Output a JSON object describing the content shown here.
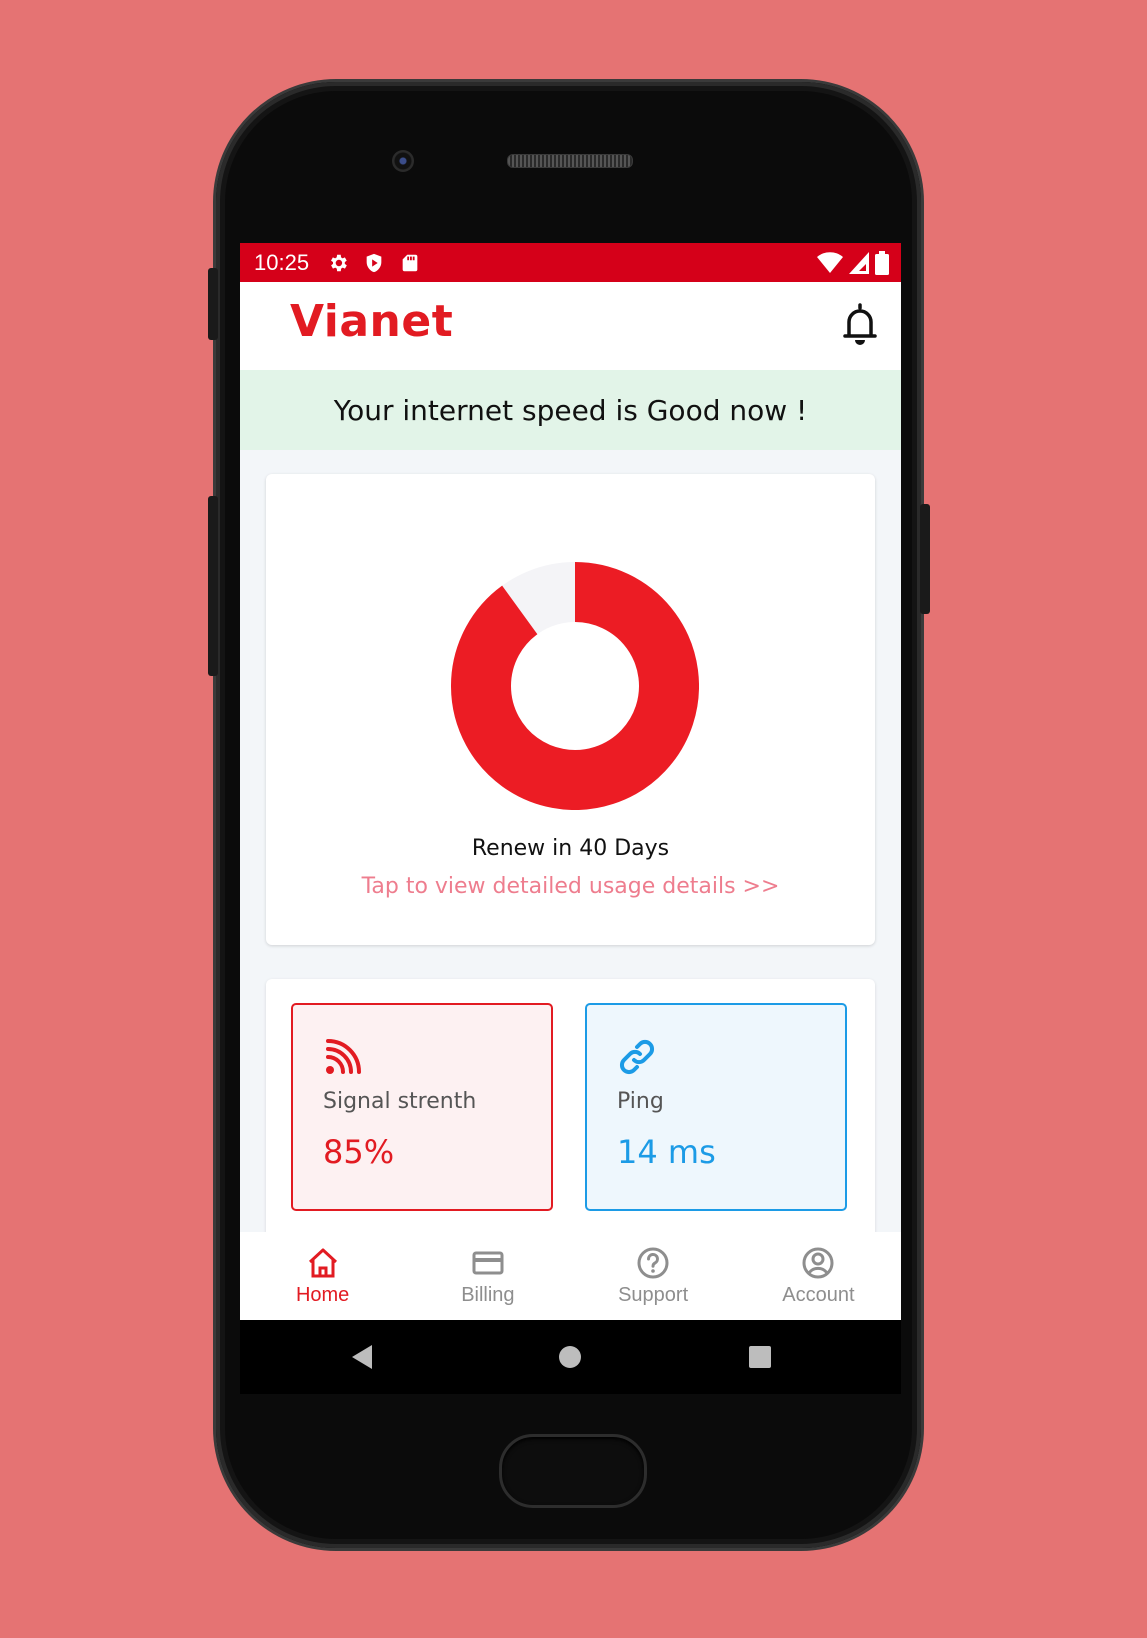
{
  "status_bar": {
    "time": "10:25",
    "left_icons": [
      "settings-icon",
      "shield-play-icon",
      "sd-card-icon"
    ],
    "right_icons": [
      "wifi-icon",
      "cell-signal-icon",
      "battery-icon"
    ]
  },
  "app_bar": {
    "brand": "Vianet",
    "notification_icon": "bell-icon"
  },
  "banner": {
    "text": "Your internet speed is Good now !"
  },
  "usage": {
    "used_fraction": 0.9,
    "renew_text": "Renew in 40 Days",
    "details_link": "Tap to view detailed usage details >>"
  },
  "stats": {
    "signal": {
      "label": "Signal strenth",
      "value": "85%",
      "icon": "rss-signal-icon"
    },
    "ping": {
      "label": "Ping",
      "value": "14 ms",
      "icon": "link-icon"
    }
  },
  "bottom_nav": {
    "items": [
      {
        "label": "Home",
        "icon": "home-icon",
        "active": true
      },
      {
        "label": "Billing",
        "icon": "card-icon",
        "active": false
      },
      {
        "label": "Support",
        "icon": "help-icon",
        "active": false
      },
      {
        "label": "Account",
        "icon": "account-icon",
        "active": false
      }
    ]
  },
  "colors": {
    "brand_red": "#e21b22",
    "status_red": "#d50019",
    "banner_green": "#e2f4e8",
    "ping_blue": "#1c9be6",
    "link_pink": "#ee7d8e"
  }
}
